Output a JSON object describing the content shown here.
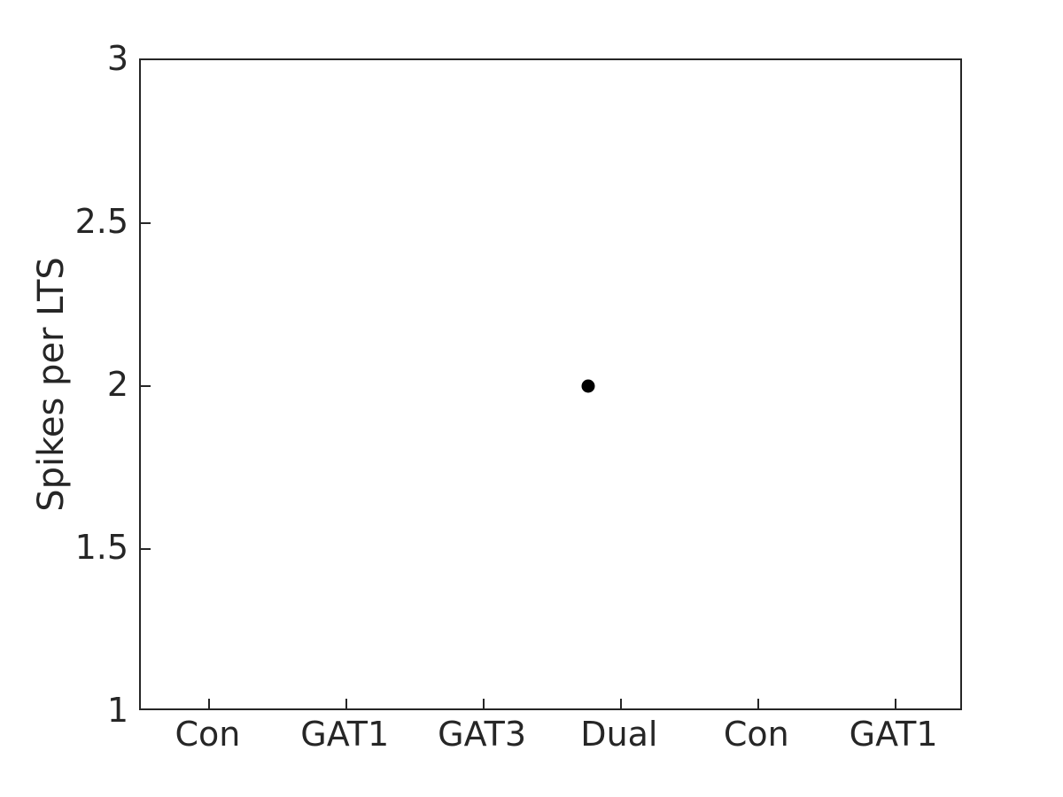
{
  "figure": {
    "background_color": "#ffffff",
    "axis_color": "#262626",
    "marker_color": "#000000"
  },
  "axes": {
    "ylabel": "Spikes per LTS",
    "xlabel": "",
    "title": ""
  },
  "yticklabels": [
    "1",
    "1.5",
    "2",
    "2.5",
    "3"
  ],
  "xticklabels": [
    "Con",
    "GAT1",
    "GAT3",
    "Dual",
    "Con",
    "GAT1"
  ],
  "chart_data": {
    "type": "scatter",
    "title": "",
    "xlabel": "",
    "ylabel": "Spikes per LTS",
    "categories": [
      "Con",
      "GAT1",
      "GAT3",
      "Dual",
      "Con",
      "GAT1"
    ],
    "x_tick_positions": [
      1,
      2,
      3,
      4,
      5,
      6
    ],
    "y_ticks": [
      1,
      1.5,
      2,
      2.5,
      3
    ],
    "xlim": [
      0.5,
      6.5
    ],
    "ylim": [
      1,
      3
    ],
    "grid": false,
    "legend": null,
    "series": [
      {
        "name": "Spikes per LTS",
        "marker": "circle",
        "color": "#000000",
        "points": [
          {
            "x": 3.76,
            "y": 2.0,
            "category": "Dual"
          }
        ]
      }
    ],
    "notes": "Single data point plotted near the Dual condition at 2 spikes per LTS; all other conditions have no data."
  }
}
